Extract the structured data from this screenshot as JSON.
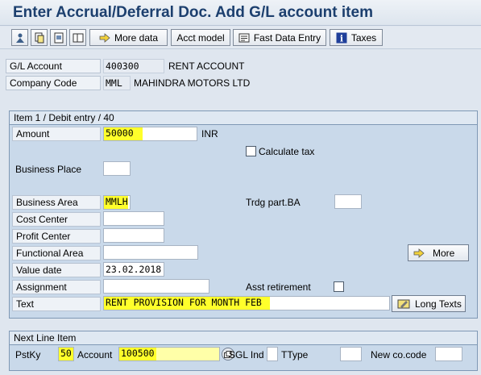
{
  "window": {
    "title": "Enter Accrual/Deferral Doc. Add G/L account item"
  },
  "toolbar": {
    "more_data": "More data",
    "acct_model": "Acct model",
    "fast_data_entry": "Fast Data Entry",
    "taxes": "Taxes"
  },
  "header": {
    "gl_account_label": "G/L Account",
    "gl_account_value": "400300",
    "gl_account_name": "RENT ACCOUNT",
    "company_code_label": "Company Code",
    "company_code_value": "MML",
    "company_name": "MAHINDRA MOTORS LTD"
  },
  "item": {
    "group_title": "Item 1 / Debit entry / 40",
    "amount_label": "Amount",
    "amount_value": "50000",
    "currency": "INR",
    "calculate_tax_label": "Calculate tax",
    "business_place_label": "Business Place",
    "business_place_value": "",
    "business_area_label": "Business Area",
    "business_area_value": "MMLH",
    "trdg_part_label": "Trdg part.BA",
    "trdg_part_value": "",
    "cost_center_label": "Cost Center",
    "cost_center_value": "",
    "profit_center_label": "Profit Center",
    "profit_center_value": "",
    "functional_area_label": "Functional Area",
    "functional_area_value": "",
    "more_button": "More",
    "value_date_label": "Value date",
    "value_date_value": "23.02.2018",
    "assignment_label": "Assignment",
    "assignment_value": "",
    "asst_retirement_label": "Asst retirement",
    "text_label": "Text",
    "text_value": "RENT PROVISION FOR MONTH FEB",
    "long_texts_button": "Long Texts"
  },
  "next_line": {
    "group_title": "Next Line Item",
    "pstky_label": "PstKy",
    "pstky_value": "50",
    "account_label": "Account",
    "account_value": "100500",
    "sgl_ind_label": "SGL Ind",
    "sgl_ind_value": "",
    "ttype_label": "TType",
    "ttype_value": "",
    "new_co_code_label": "New co.code",
    "new_co_code_value": ""
  },
  "colors": {
    "title": "#1c3f6e",
    "highlight": "#ffff2b",
    "group_bg": "#c9d9ea"
  },
  "icons": [
    "display-icon",
    "copy-icon",
    "hold-icon",
    "pages-icon",
    "arrow-right-icon",
    "info-icon",
    "search-help-icon"
  ]
}
